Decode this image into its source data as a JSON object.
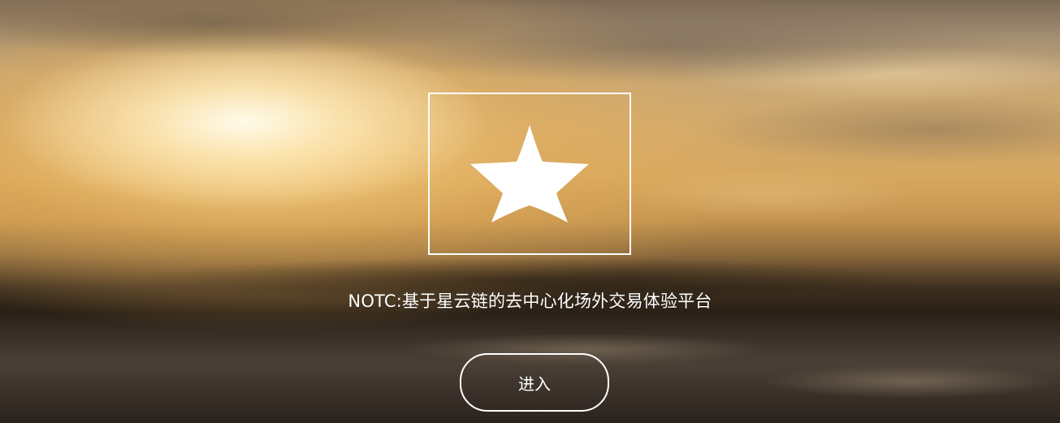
{
  "hero": {
    "logo_icon": "star-icon",
    "tagline": "NOTC:基于星云链的去中心化场外交易体验平台",
    "enter_button_label": "进入"
  },
  "colors": {
    "foreground": "#ffffff",
    "background_warm": "#d6a75f",
    "background_dark": "#2a2016"
  }
}
